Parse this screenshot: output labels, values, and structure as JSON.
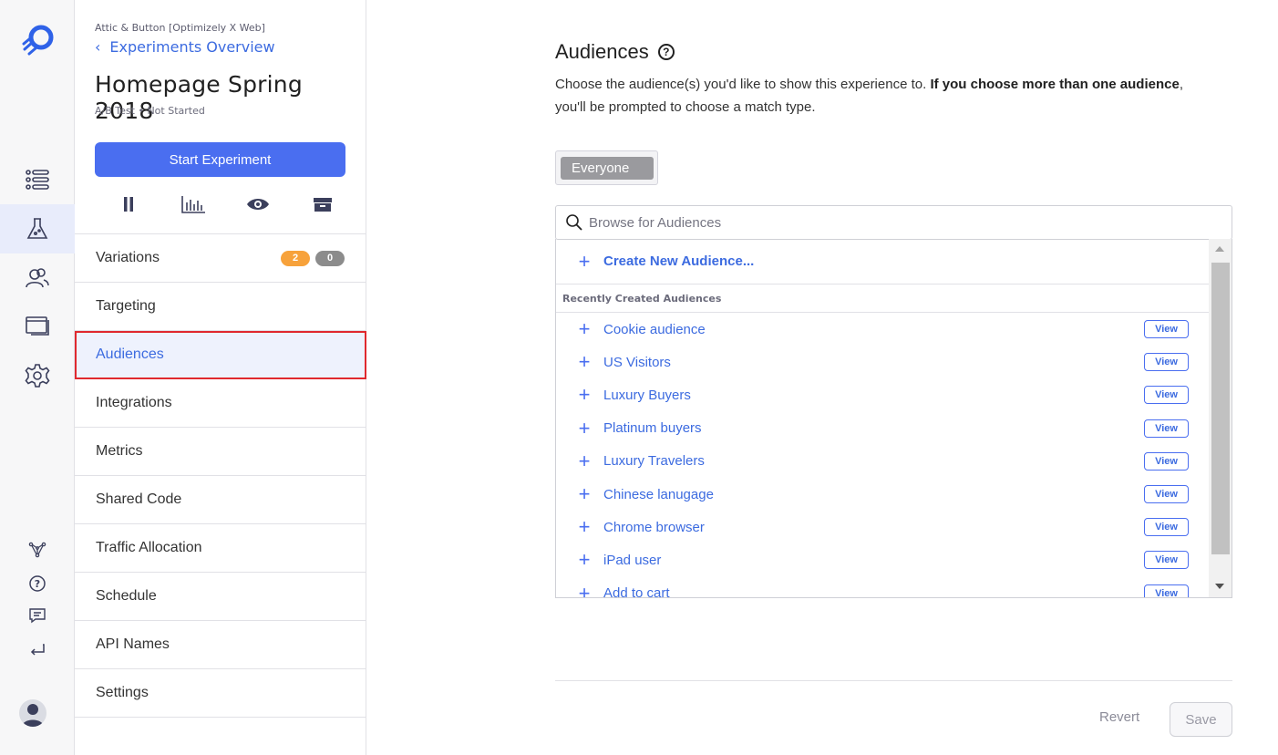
{
  "rail": {
    "logo_icon": "rocket-logo-icon",
    "items": [
      {
        "name": "list-icon",
        "active": false
      },
      {
        "name": "flask-icon",
        "active": true
      },
      {
        "name": "audiences-icon",
        "active": false
      },
      {
        "name": "pages-icon",
        "active": false
      },
      {
        "name": "gear-icon",
        "active": false
      }
    ],
    "bottom_items": [
      "nodes-icon",
      "help-icon",
      "feedback-icon",
      "return-icon"
    ],
    "avatar_icon": "user-avatar-icon"
  },
  "sidebar": {
    "project": "Attic & Button [Optimizely X Web]",
    "back_label": "Experiments Overview",
    "title": "Homepage Spring 2018",
    "meta_type": "A/B Test",
    "meta_status": "Not Started",
    "start_button": "Start Experiment",
    "action_icons": [
      "pause-icon",
      "results-chart-icon",
      "preview-eye-icon",
      "archive-icon"
    ],
    "menu": [
      {
        "label": "Variations",
        "badges": [
          "2",
          "0"
        ]
      },
      {
        "label": "Targeting"
      },
      {
        "label": "Audiences",
        "active": true
      },
      {
        "label": "Integrations"
      },
      {
        "label": "Metrics"
      },
      {
        "label": "Shared Code"
      },
      {
        "label": "Traffic Allocation"
      },
      {
        "label": "Schedule"
      },
      {
        "label": "API Names"
      },
      {
        "label": "Settings"
      }
    ],
    "badge_colors": {
      "orange": "#f7a23b",
      "gray": "#8c8c8c"
    }
  },
  "main": {
    "heading": "Audiences",
    "help_icon": "?",
    "description_start": "Choose the audience(s) you'd like to show this experience to. ",
    "description_bold": "If you choose more than one audience",
    "description_end": ", you'll be prompted to choose a match type.",
    "selected_chip": "Everyone",
    "search_placeholder": "Browse for Audiences",
    "create_label": "Create New Audience...",
    "section_label": "Recently Created Audiences",
    "view_label": "View",
    "audiences": [
      "Cookie audience",
      "US Visitors",
      "Luxury Buyers",
      "Platinum buyers",
      "Luxury Travelers",
      "Chinese lanugage",
      "Chrome browser",
      "iPad user",
      "Add to cart"
    ],
    "revert_label": "Revert",
    "save_label": "Save"
  },
  "colors": {
    "accent": "#4a6ef0",
    "link": "#3c6be0",
    "highlight_border": "#e0292e"
  }
}
